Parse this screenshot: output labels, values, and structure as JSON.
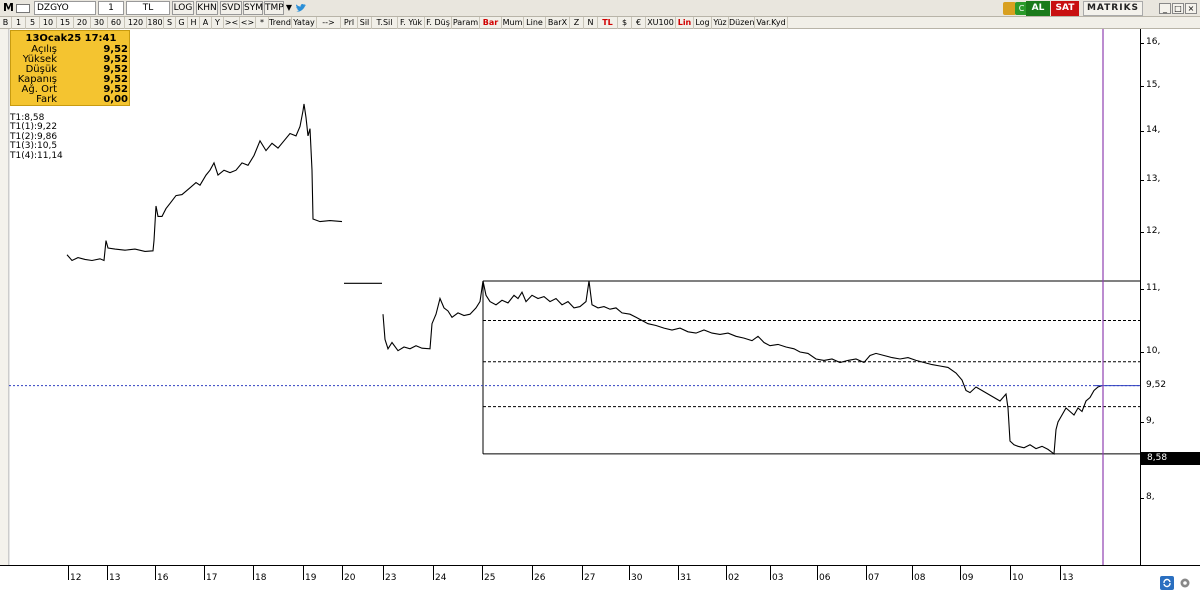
{
  "titlebar": {
    "menu_letter": "M",
    "symbol": "DZGYO",
    "period": "1",
    "currency": "TL",
    "buttons": [
      "LOG",
      "KHN",
      "SVD",
      "SYM",
      "TMP"
    ],
    "al_label": "AL",
    "sat_label": "SAT",
    "brand": "MATRIKS"
  },
  "toolbar": {
    "items": [
      "B",
      "1",
      "5",
      "10",
      "15",
      "20",
      "30",
      "60",
      "120",
      "180",
      "S",
      "G",
      "H",
      "A",
      "Y",
      "><",
      "<>",
      "*",
      "Trend",
      "Yatay",
      "-->",
      "Prl",
      "Sil",
      "T.Sil",
      "F. Yük",
      "F. Düş",
      "Param",
      "Bar",
      "Mum",
      "Line",
      "BarX",
      "Z",
      "N",
      "TL",
      "$",
      "€",
      "XU100",
      "Lin",
      "Log",
      "Yüz",
      "Düzen",
      "Var.Kyd"
    ]
  },
  "infobox": {
    "title": "13Ocak25 17:41",
    "rows": [
      {
        "label": "Açılış",
        "value": "9,52"
      },
      {
        "label": "Yüksek",
        "value": "9,52"
      },
      {
        "label": "Düşük",
        "value": "9,52"
      },
      {
        "label": "Kapanış",
        "value": "9,52"
      },
      {
        "label": "Ağ. Ort",
        "value": "9,52"
      },
      {
        "label": "Fark",
        "value": "0,00"
      }
    ]
  },
  "levels": [
    "T1:8,58",
    "T1(1):9,22",
    "T1(2):9,86",
    "T1(3):10,5",
    "T1(4):11,14"
  ],
  "chart_data": {
    "type": "line",
    "y_ticks": [
      "16,",
      "15,",
      "14,",
      "13,",
      "12,",
      "11,",
      "10,",
      "9,",
      "8,"
    ],
    "y_values": [
      16,
      15,
      14,
      13,
      12,
      11,
      10,
      9,
      8
    ],
    "x_ticks": [
      "12",
      "13",
      "16",
      "17",
      "18",
      "19",
      "20",
      "23",
      "24",
      "25",
      "26",
      "27",
      "30",
      "31",
      "02",
      "03",
      "06",
      "07",
      "08",
      "09",
      "10",
      "13"
    ],
    "current_price": "9,52",
    "last_label": "8,58",
    "fib_levels": [
      11.14,
      10.5,
      9.86,
      9.22,
      8.58
    ],
    "ylim": [
      7.2,
      16.3
    ]
  },
  "colors": {
    "bar_red": "#d10000",
    "info_bg": "#f4c430",
    "crosshair_v": "#9040b0",
    "current_line": "#3040c0",
    "al": "#1a7a1a",
    "sat": "#c81010"
  }
}
